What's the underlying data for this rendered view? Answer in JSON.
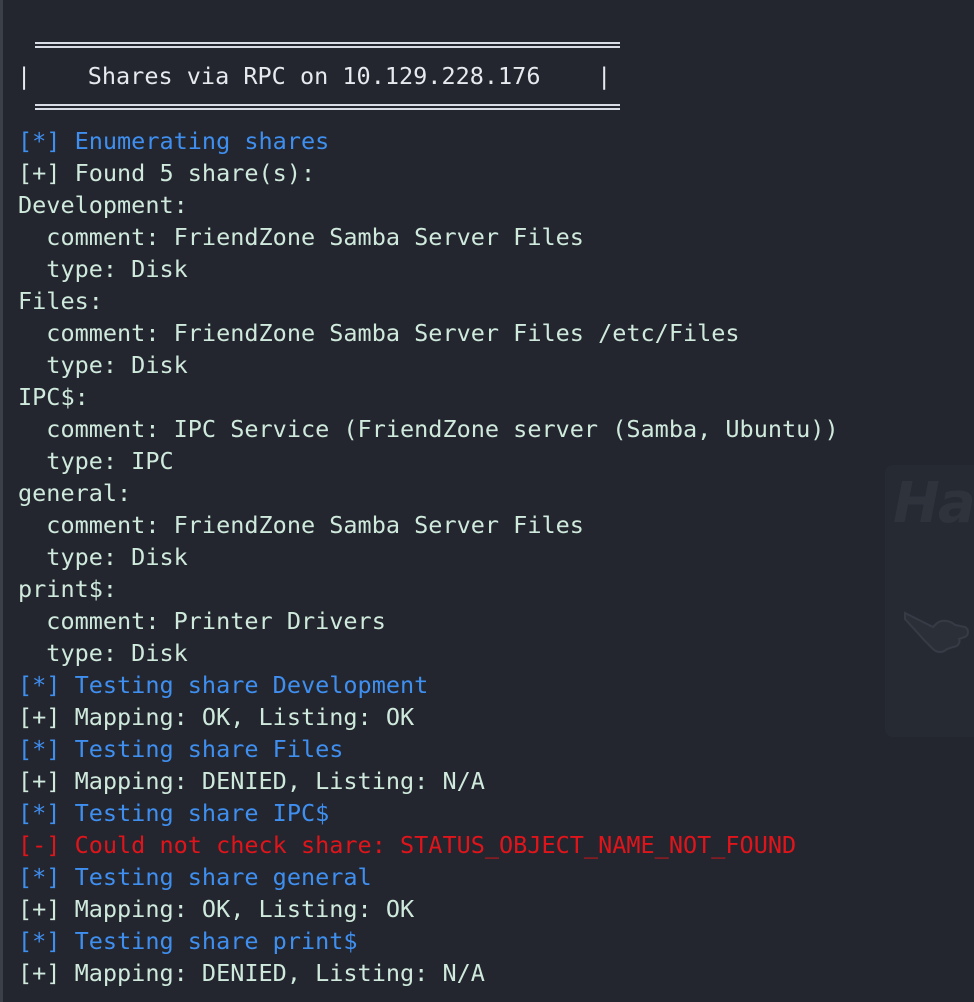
{
  "banner": {
    "title": "|    Shares via RPC on 10.129.228.176    |"
  },
  "watermark": {
    "text": "Ha"
  },
  "colors": {
    "background": "#23262e",
    "info_blue": "#3f8ff0",
    "output_green": "#cfe9dc",
    "error_red": "#e0141b",
    "banner_white": "#e6e9ee"
  },
  "lines": [
    {
      "text": "[*] Enumerating shares",
      "kind": "info"
    },
    {
      "text": "[+] Found 5 share(s):",
      "kind": "output"
    },
    {
      "text": "Development:",
      "kind": "output"
    },
    {
      "text": "  comment: FriendZone Samba Server Files",
      "kind": "output"
    },
    {
      "text": "  type: Disk",
      "kind": "output"
    },
    {
      "text": "Files:",
      "kind": "output"
    },
    {
      "text": "  comment: FriendZone Samba Server Files /etc/Files",
      "kind": "output"
    },
    {
      "text": "  type: Disk",
      "kind": "output"
    },
    {
      "text": "IPC$:",
      "kind": "output"
    },
    {
      "text": "  comment: IPC Service (FriendZone server (Samba, Ubuntu))",
      "kind": "output"
    },
    {
      "text": "  type: IPC",
      "kind": "output"
    },
    {
      "text": "general:",
      "kind": "output"
    },
    {
      "text": "  comment: FriendZone Samba Server Files",
      "kind": "output"
    },
    {
      "text": "  type: Disk",
      "kind": "output"
    },
    {
      "text": "print$:",
      "kind": "output"
    },
    {
      "text": "  comment: Printer Drivers",
      "kind": "output"
    },
    {
      "text": "  type: Disk",
      "kind": "output"
    },
    {
      "text": "[*] Testing share Development",
      "kind": "info"
    },
    {
      "text": "[+] Mapping: OK, Listing: OK",
      "kind": "output"
    },
    {
      "text": "[*] Testing share Files",
      "kind": "info"
    },
    {
      "text": "[+] Mapping: DENIED, Listing: N/A",
      "kind": "output"
    },
    {
      "text": "[*] Testing share IPC$",
      "kind": "info"
    },
    {
      "text": "[-] Could not check share: STATUS_OBJECT_NAME_NOT_FOUND",
      "kind": "error"
    },
    {
      "text": "[*] Testing share general",
      "kind": "info"
    },
    {
      "text": "[+] Mapping: OK, Listing: OK",
      "kind": "output"
    },
    {
      "text": "[*] Testing share print$",
      "kind": "info"
    },
    {
      "text": "[+] Mapping: DENIED, Listing: N/A",
      "kind": "output"
    }
  ]
}
